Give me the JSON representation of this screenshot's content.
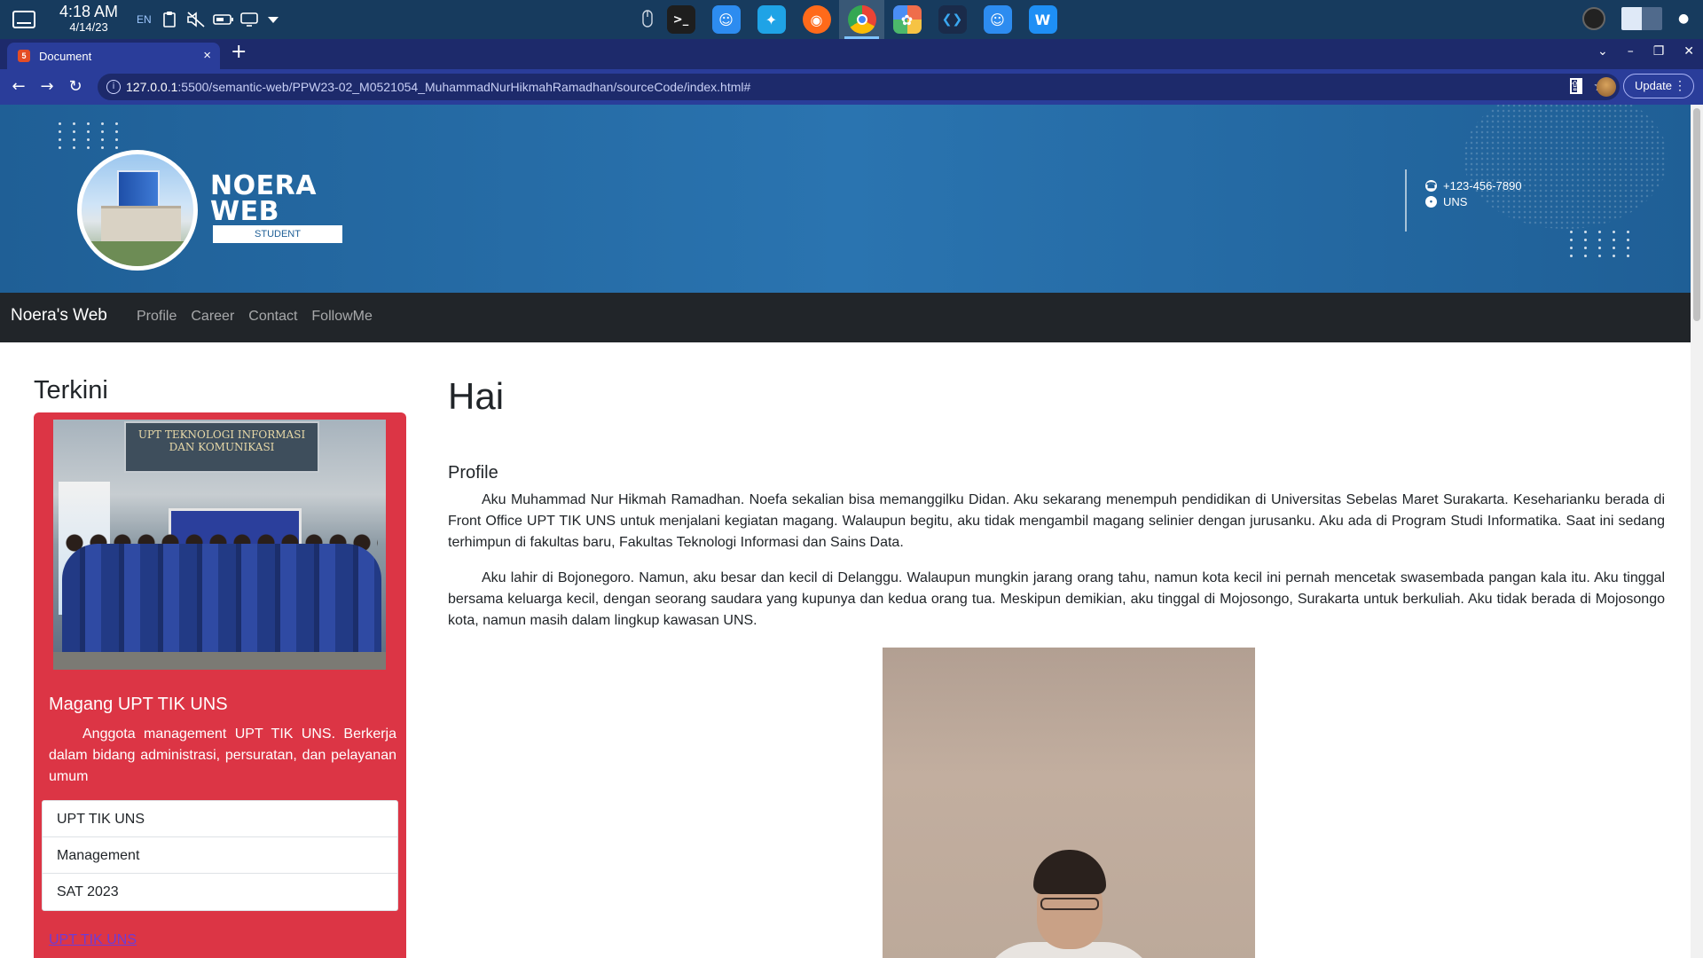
{
  "os": {
    "time": "4:18 AM",
    "date": "4/14/23",
    "lang": "EN",
    "dock_apps": [
      {
        "name": "terminal",
        "glyph": ">_",
        "color": "#1e1e1e"
      },
      {
        "name": "finder",
        "glyph": "☺",
        "color": "#2d8cf0"
      },
      {
        "name": "deepin-store",
        "glyph": "✦",
        "color": "#1fa3e6"
      },
      {
        "name": "firefox",
        "glyph": "◉",
        "color": "#ff6a1a"
      },
      {
        "name": "chrome",
        "glyph": "◎",
        "color": "#34a853"
      },
      {
        "name": "photos",
        "glyph": "✿",
        "color": "#ef6d4b"
      },
      {
        "name": "vscode",
        "glyph": "❮❯",
        "color": "#1a2b4a"
      },
      {
        "name": "file-manager",
        "glyph": "☺",
        "color": "#2d8cf0"
      },
      {
        "name": "wps",
        "glyph": "W",
        "color": "#1e8ff5"
      }
    ]
  },
  "browser": {
    "tab_title": "Document",
    "url_host": "127.0.0.1",
    "url_rest": ":5500/semantic-web/PPW23-02_M0521054_MuhammadNurHikmahRamadhan/sourceCode/index.html#",
    "update_label": "Update"
  },
  "banner": {
    "brand_line1": "NOERA",
    "brand_line2": "WEB",
    "brand_sub": "STUDENT",
    "phone": "+123-456-7890",
    "location": "UNS"
  },
  "navbar": {
    "brand": "Noera's Web",
    "links": [
      "Profile",
      "Career",
      "Contact",
      "FollowMe"
    ]
  },
  "sidebar": {
    "heading": "Terkini",
    "card": {
      "image_sign": "UPT TEKNOLOGI INFORMASI DAN KOMUNIKASI",
      "title": "Magang UPT TIK UNS",
      "text": "Anggota management UPT TIK UNS. Berkerja dalam bidang administrasi, persuratan, dan pelayanan umum",
      "list": [
        "UPT TIK UNS",
        "Management",
        "SAT 2023"
      ],
      "link": "UPT TIK UNS"
    }
  },
  "main": {
    "heading": "Hai",
    "section": "Profile",
    "paragraphs": [
      "Aku Muhammad Nur Hikmah Ramadhan. Noefa sekalian bisa memanggilku Didan. Aku sekarang menempuh pendidikan di Universitas Sebelas Maret Surakarta. Keseharianku berada di Front Office UPT TIK UNS untuk menjalani kegiatan magang. Walaupun begitu, aku tidak mengambil magang selinier dengan jurusanku. Aku ada di Program Studi Informatika. Saat ini sedang terhimpun di fakultas baru, Fakultas Teknologi Informasi dan Sains Data.",
      "Aku lahir di Bojonegoro. Namun, aku besar dan kecil di Delanggu. Walaupun mungkin jarang orang tahu, namun kota kecil ini pernah mencetak swasembada pangan kala itu. Aku tinggal bersama keluarga kecil, dengan seorang saudara yang kupunya dan kedua orang tua. Meskipun demikian, aku tinggal di Mojosongo, Surakarta untuk berkuliah. Aku tidak berada di Mojosongo kota, namun masih dalam lingkup kawasan UNS."
    ]
  }
}
